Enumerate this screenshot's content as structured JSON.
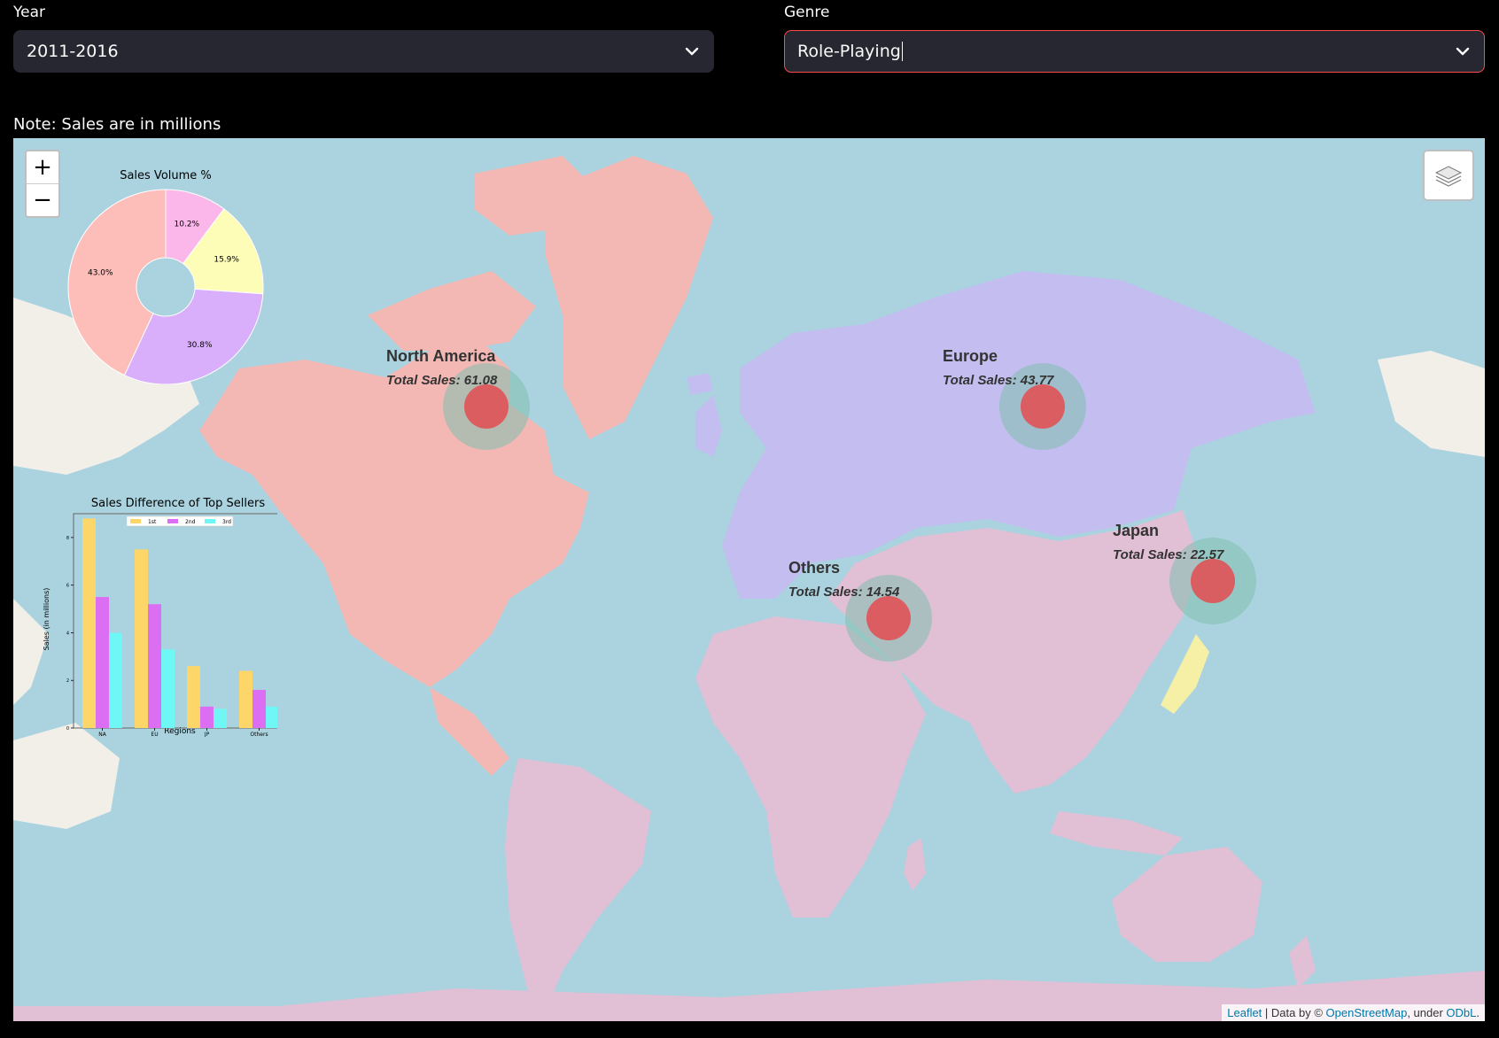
{
  "year": {
    "label": "Year",
    "value": "2011-2016"
  },
  "genre": {
    "label": "Genre",
    "value": "Role-Playing"
  },
  "note": "Note: Sales are in millions",
  "map": {
    "zoom_in": "+",
    "zoom_out": "−",
    "regions": [
      {
        "name": "North America",
        "sales": "Total Sales: 61.08"
      },
      {
        "name": "Europe",
        "sales": "Total Sales: 43.77"
      },
      {
        "name": "Others",
        "sales": "Total Sales: 14.54"
      },
      {
        "name": "Japan",
        "sales": "Total Sales: 22.57"
      }
    ],
    "attribution": {
      "leaflet": "Leaflet",
      "sep1": " | Data by © ",
      "osm": "OpenStreetMap",
      "sep2": ", under ",
      "odbl": "ODbL",
      "end": "."
    },
    "colors": {
      "water": "#aad3df",
      "americas_na": "#f4b8b4",
      "europe_russia": "#c3bdf0",
      "asia_africa_sa": "#e1bfd5",
      "japan": "#f6f0a6",
      "marker_inner": "#e05256",
      "marker_outer": "#7fbfae"
    }
  },
  "chart_data": [
    {
      "type": "pie",
      "title": "Sales Volume %",
      "slices": [
        {
          "label": "10.2%",
          "value": 10.2,
          "color": "#fbb6ea"
        },
        {
          "label": "15.9%",
          "value": 15.9,
          "color": "#fdfdb8"
        },
        {
          "label": "30.8%",
          "value": 30.8,
          "color": "#d9aefa"
        },
        {
          "label": "43.0%",
          "value": 43.0,
          "color": "#fdbdb8"
        }
      ],
      "donut": true
    },
    {
      "type": "bar",
      "title": "Sales Difference of Top Sellers",
      "xlabel": "Regions",
      "ylabel": "Sales (in millions)",
      "categories": [
        "NA",
        "EU",
        "JP",
        "Others"
      ],
      "ylim": [
        0,
        9
      ],
      "yticks": [
        "0",
        "2",
        "4",
        "6",
        "8"
      ],
      "legend_position": "top-center",
      "series": [
        {
          "name": "1st",
          "color": "#fcd668",
          "values": [
            8.8,
            7.5,
            2.6,
            2.4
          ]
        },
        {
          "name": "2nd",
          "color": "#dc6ef4",
          "values": [
            5.5,
            5.2,
            0.9,
            1.6
          ]
        },
        {
          "name": "3rd",
          "color": "#6ef7f4",
          "values": [
            4.0,
            3.3,
            0.8,
            0.9
          ]
        }
      ]
    }
  ]
}
